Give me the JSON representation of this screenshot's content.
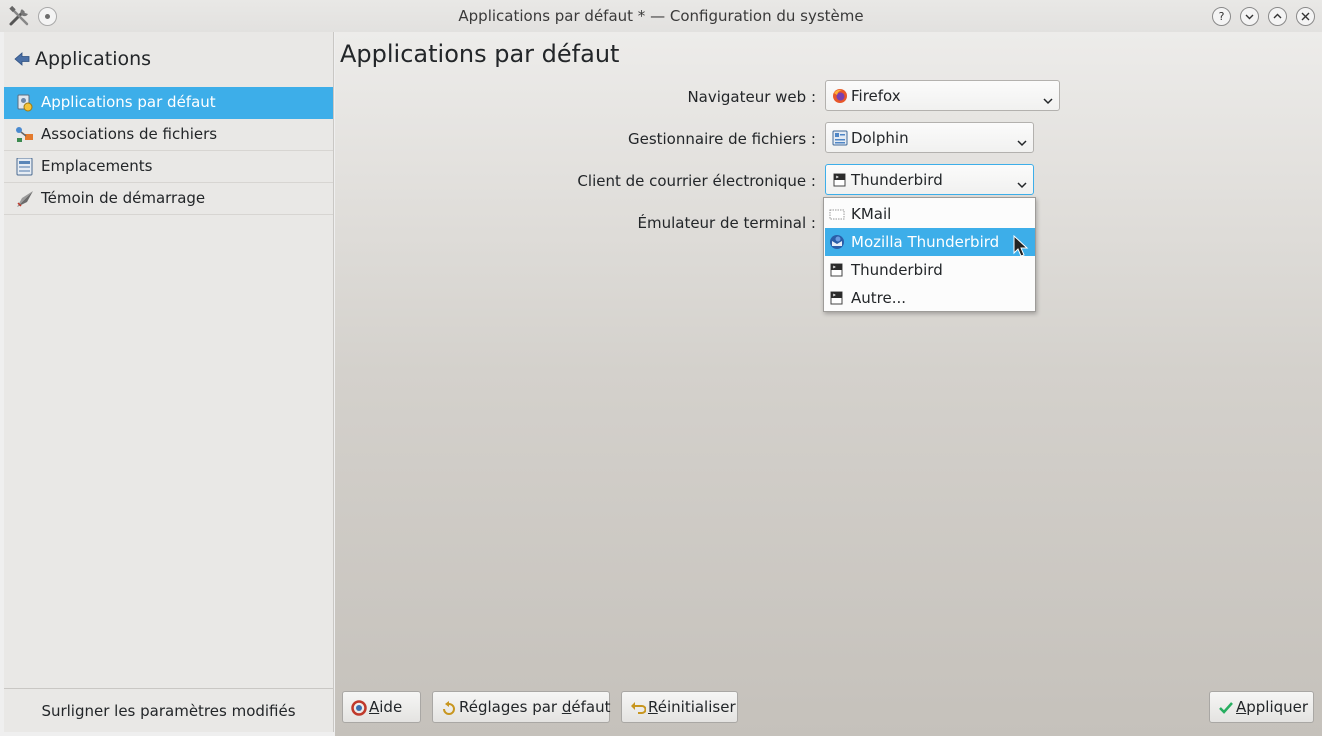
{
  "window": {
    "title": "Applications par défaut * — Configuration du système",
    "buttons": [
      "?",
      "⌄",
      "⌃",
      "✕"
    ]
  },
  "sidebar": {
    "title": "Applications",
    "items": [
      {
        "label": "Applications par défaut",
        "icon": "default-apps-icon",
        "active": true
      },
      {
        "label": "Associations de fichiers",
        "icon": "file-associations-icon",
        "active": false
      },
      {
        "label": "Emplacements",
        "icon": "locations-icon",
        "active": false
      },
      {
        "label": "Témoin de démarrage",
        "icon": "launch-feedback-icon",
        "active": false
      }
    ],
    "footer": "Surligner les paramètres modifiés"
  },
  "main": {
    "title": "Applications par défaut",
    "rows": [
      {
        "label": "Navigateur web :",
        "value": "Firefox",
        "icon": "firefox-icon"
      },
      {
        "label": "Gestionnaire de fichiers :",
        "value": "Dolphin",
        "icon": "dolphin-icon"
      },
      {
        "label": "Client de courrier électronique :",
        "value": "Thunderbird",
        "icon": "terminal-app-icon"
      },
      {
        "label": "Émulateur de terminal :",
        "value": "",
        "icon": ""
      }
    ]
  },
  "popup": {
    "options": [
      {
        "label": "KMail",
        "icon": "kmail-icon",
        "selected": false
      },
      {
        "label": "Mozilla Thunderbird",
        "icon": "thunderbird-icon",
        "selected": true
      },
      {
        "label": "Thunderbird",
        "icon": "terminal-app-icon",
        "selected": false
      },
      {
        "label": "Autre...",
        "icon": "terminal-app-icon",
        "selected": false
      }
    ]
  },
  "buttons": {
    "help": {
      "accel": "A",
      "rest": "ide"
    },
    "defaults": {
      "pre": "Réglages par ",
      "accel": "d",
      "rest": "éfaut"
    },
    "reset": {
      "accel": "R",
      "rest": "éinitialiser"
    },
    "apply": {
      "accel": "A",
      "rest": "ppliquer"
    }
  },
  "colors": {
    "accent": "#3daee9",
    "text": "#232629"
  }
}
